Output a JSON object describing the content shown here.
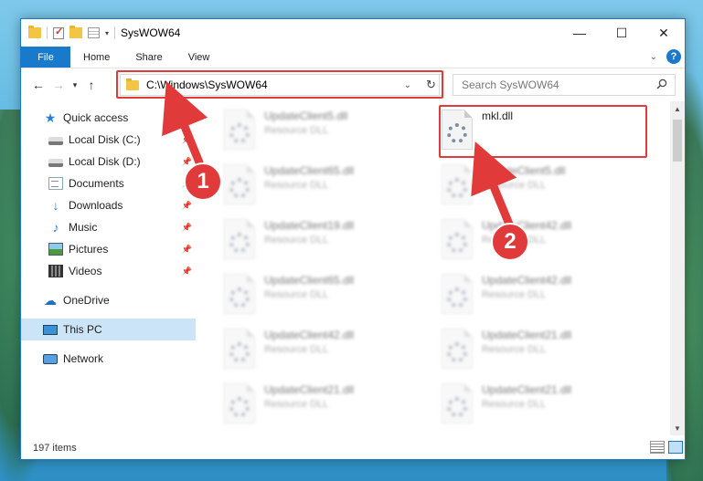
{
  "window": {
    "title": "SysWOW64",
    "controls": {
      "minimize": "—",
      "maximize": "☐",
      "close": "✕"
    }
  },
  "ribbon": {
    "tabs": [
      "File",
      "Home",
      "Share",
      "View"
    ]
  },
  "nav": {
    "back": "←",
    "forward": "→",
    "recent": "▾",
    "up": "↑",
    "address": "C:\\Windows\\SysWOW64",
    "search_placeholder": "Search SysWOW64"
  },
  "sidebar": {
    "items": [
      {
        "label": "Quick access",
        "icon": "star-icon"
      },
      {
        "label": "Local Disk (C:)",
        "icon": "disk-icon",
        "pinned": true
      },
      {
        "label": "Local Disk (D:)",
        "icon": "disk-icon",
        "pinned": true
      },
      {
        "label": "Documents",
        "icon": "documents-icon",
        "pinned": true
      },
      {
        "label": "Downloads",
        "icon": "downloads-icon",
        "pinned": true
      },
      {
        "label": "Music",
        "icon": "music-icon",
        "pinned": true
      },
      {
        "label": "Pictures",
        "icon": "pictures-icon",
        "pinned": true
      },
      {
        "label": "Videos",
        "icon": "videos-icon",
        "pinned": true
      },
      {
        "label": "OneDrive",
        "icon": "cloud-icon"
      },
      {
        "label": "This PC",
        "icon": "pc-icon",
        "selected": true
      },
      {
        "label": "Network",
        "icon": "network-icon"
      }
    ]
  },
  "files": {
    "left": [
      {
        "name": "UpdateClient5.dll",
        "type": "Resource DLL"
      },
      {
        "name": "UpdateClient65.dll",
        "type": "Resource DLL"
      },
      {
        "name": "UpdateClient19.dll",
        "type": "Resource DLL"
      },
      {
        "name": "UpdateClient65.dll",
        "type": "Resource DLL"
      },
      {
        "name": "UpdateClient42.dll",
        "type": "Resource DLL"
      },
      {
        "name": "UpdateClient21.dll",
        "type": "Resource DLL"
      }
    ],
    "right": [
      {
        "name": "mkl.dll",
        "type": ""
      },
      {
        "name": "UpdateClient5.dll",
        "type": "Resource DLL"
      },
      {
        "name": "UpdateClient42.dll",
        "type": "Resource DLL"
      },
      {
        "name": "UpdateClient42.dll",
        "type": "Resource DLL"
      },
      {
        "name": "UpdateClient21.dll",
        "type": "Resource DLL"
      },
      {
        "name": "UpdateClient21.dll",
        "type": "Resource DLL"
      }
    ]
  },
  "status": {
    "item_count": "197 items"
  },
  "annotations": {
    "badge1": "1",
    "badge2": "2",
    "color": "#e03a3a"
  },
  "colors": {
    "accent": "#1979ca",
    "selection": "#cce4f7"
  }
}
